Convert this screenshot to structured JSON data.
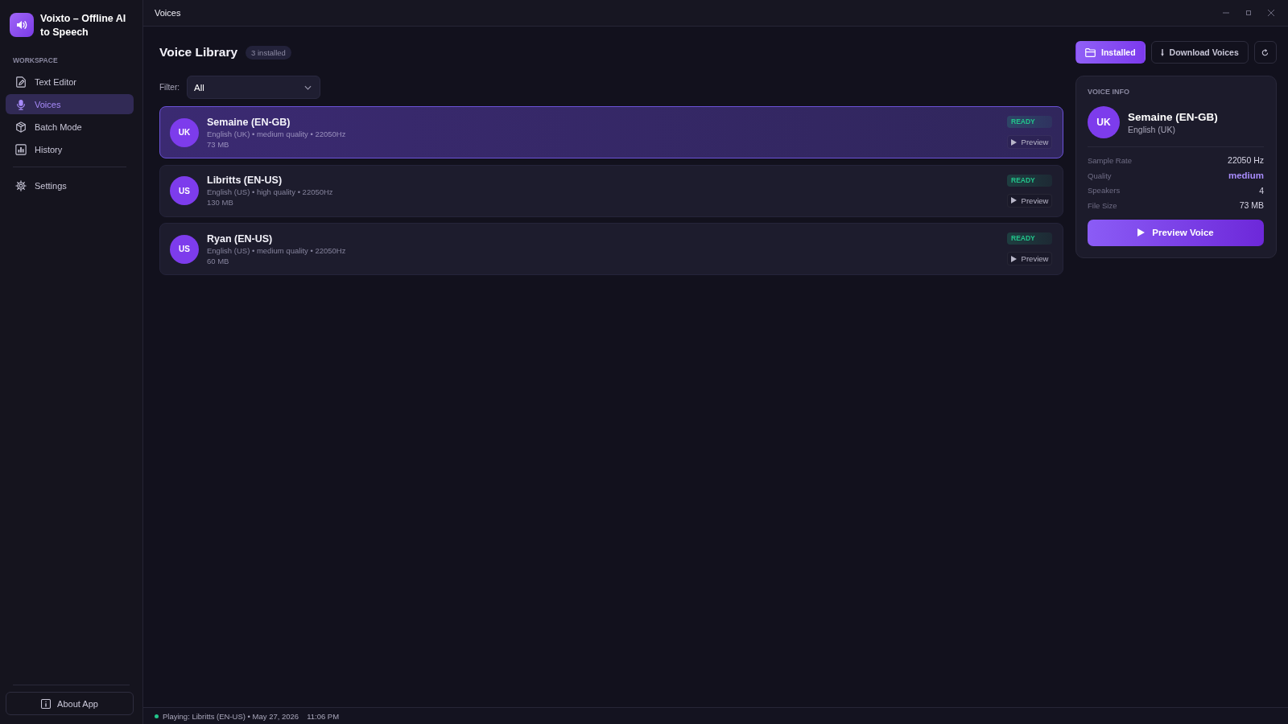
{
  "window": {
    "title": "Voices"
  },
  "app": {
    "title": "Voixto – Offline AI to Speech"
  },
  "sidebar": {
    "section_label": "WORKSPACE",
    "items": [
      {
        "label": "Text Editor",
        "selected": false
      },
      {
        "label": "Voices",
        "selected": true
      },
      {
        "label": "Batch Mode",
        "selected": false
      },
      {
        "label": "History",
        "selected": false
      }
    ],
    "footer_items": [
      {
        "label": "Settings",
        "selected": false
      }
    ],
    "about_button": "About App"
  },
  "page": {
    "heading": "Voice Library",
    "count_badge": "3 installed"
  },
  "toolbar": {
    "tabs": [
      {
        "label": "Installed",
        "selected": true
      },
      {
        "label": "Download Voices",
        "selected": false
      }
    ]
  },
  "filter": {
    "label": "Filter:",
    "value": "All"
  },
  "voices": [
    {
      "initials": "UK",
      "name": "Semaine (EN-GB)",
      "details": "English (UK) • medium quality • 22050Hz",
      "size": "73 MB",
      "status": "READY",
      "preview": "Preview",
      "selected": true
    },
    {
      "initials": "US",
      "name": "Libritts (EN-US)",
      "details": "English (US) • high quality • 22050Hz",
      "size": "130 MB",
      "status": "READY",
      "preview": "Preview",
      "selected": false
    },
    {
      "initials": "US",
      "name": "Ryan (EN-US)",
      "details": "English (US) • medium quality • 22050Hz",
      "size": "60 MB",
      "status": "READY",
      "preview": "Preview",
      "selected": false
    }
  ],
  "voice_info": {
    "label": "VOICE INFO",
    "initials": "UK",
    "name": "Semaine (EN-GB)",
    "language": "English (UK)",
    "fields": [
      {
        "label": "Sample Rate",
        "value": "22050 Hz",
        "kind": "plain"
      },
      {
        "label": "Quality",
        "value": "medium",
        "kind": "accent"
      },
      {
        "label": "Speakers",
        "value": "4",
        "kind": "plain"
      },
      {
        "label": "File Size",
        "value": "73 MB",
        "kind": "plain"
      }
    ],
    "button": "Preview Voice"
  },
  "status_bar": {
    "text": "Playing: Libritts (EN-US) • May 27, 2026",
    "time": "11:06 PM"
  }
}
